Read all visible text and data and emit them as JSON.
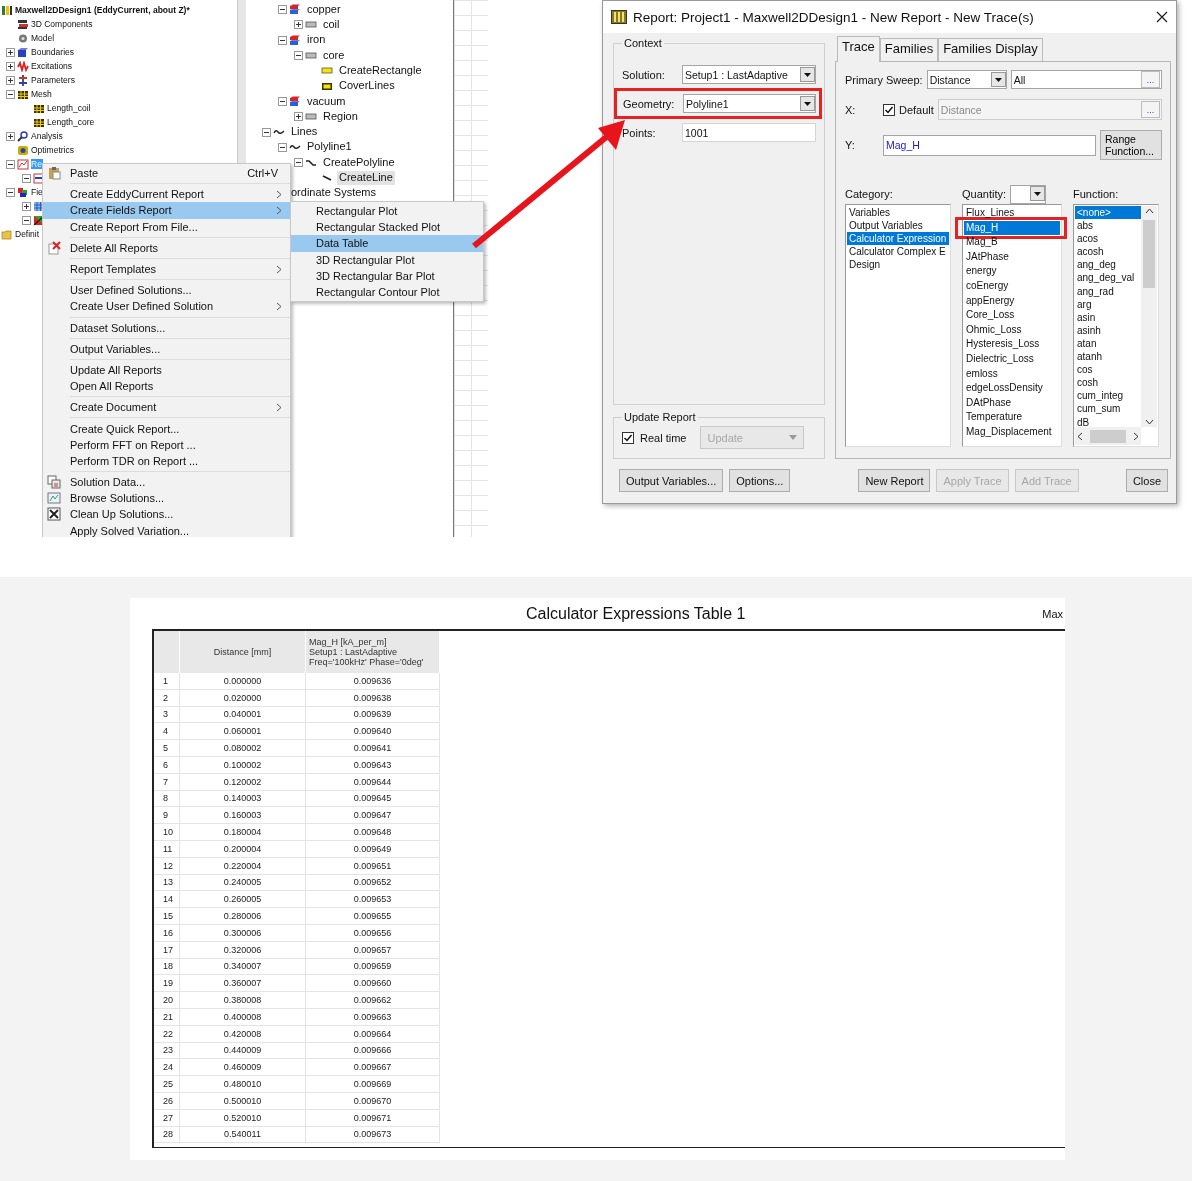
{
  "left_tree": {
    "focused": true,
    "nodes": [
      {
        "label": "Maxwell2DDesign1 (EddyCurrent, about Z)*",
        "kind": "design",
        "selected": false,
        "children": [
          {
            "label": "3D Components",
            "kind": "components",
            "selected": false
          },
          {
            "label": "Model",
            "kind": "model",
            "selected": false
          },
          {
            "label": "Boundaries",
            "kind": "boundary",
            "expanded": false,
            "selected": false
          },
          {
            "label": "Excitations",
            "kind": "excitation",
            "expanded": false,
            "selected": false
          },
          {
            "label": "Parameters",
            "kind": "parameter",
            "expanded": false,
            "selected": false
          },
          {
            "label": "Mesh",
            "kind": "mesh",
            "expanded": true,
            "selected": false,
            "children": [
              {
                "label": "Length_coil",
                "kind": "mesh",
                "selected": false
              },
              {
                "label": "Length_core",
                "kind": "mesh",
                "selected": false
              }
            ]
          },
          {
            "label": "Analysis",
            "kind": "analysis",
            "expanded": false,
            "selected": false
          },
          {
            "label": "Optimetrics",
            "kind": "optimetrics",
            "selected": false
          },
          {
            "label": "Re",
            "kind": "results",
            "expanded": true,
            "selected": true,
            "children": [
              {
                "kind": "plot",
                "expanded": true
              }
            ]
          },
          {
            "label": "Fie",
            "kind": "fields",
            "expanded": true,
            "selected": false,
            "children": [
              {
                "kind": "grid",
                "expanded": false
              },
              {
                "kind": "overlay",
                "expanded": true
              }
            ]
          }
        ]
      },
      {
        "label": "Definit",
        "kind": "folder",
        "selected": false
      }
    ]
  },
  "middle_tree": {
    "focused": false,
    "nodes": [
      {
        "children": [
          {
            "label": "copper",
            "kind": "material",
            "expanded": true,
            "selected": false,
            "children": [
              {
                "label": "coil",
                "kind": "object",
                "expanded": false,
                "selected": false
              }
            ]
          },
          {
            "label": "iron",
            "kind": "material",
            "expanded": true,
            "selected": false,
            "children": [
              {
                "label": "core",
                "kind": "object",
                "expanded": true,
                "selected": false,
                "children": [
                  {
                    "label": "CreateRectangle",
                    "kind": "rectangle",
                    "selected": false
                  },
                  {
                    "label": "CoverLines",
                    "kind": "cover",
                    "selected": false
                  }
                ]
              }
            ]
          },
          {
            "label": "vacuum",
            "kind": "material",
            "expanded": true,
            "selected": false,
            "children": [
              {
                "label": "Region",
                "kind": "object",
                "expanded": false,
                "selected": false
              }
            ]
          }
        ]
      },
      {
        "label": "Lines",
        "kind": "line",
        "expanded": true,
        "selected": false,
        "children": [
          {
            "label": "Polyline1",
            "kind": "line",
            "expanded": true,
            "selected": false,
            "children": [
              {
                "label": "CreatePolyline",
                "kind": "polyline",
                "expanded": true,
                "selected": false,
                "children": [
                  {
                    "label": "CreateLine",
                    "kind": "segment",
                    "selected": true
                  }
                ]
              }
            ]
          }
        ]
      },
      {
        "label": "ordinate Systems",
        "selected": false
      }
    ]
  },
  "context_menu": {
    "groups": [
      [
        {
          "label": "Paste",
          "shortcut": "Ctrl+V",
          "kind": "paste",
          "submenu": false,
          "selected": false
        }
      ],
      [
        {
          "label": "Create EddyCurrent Report",
          "submenu": true,
          "selected": false
        },
        {
          "label": "Create Fields Report",
          "submenu": true,
          "selected": true
        },
        {
          "label": "Create Report From File...",
          "submenu": false,
          "selected": false
        }
      ],
      [
        {
          "label": "Delete All Reports",
          "kind": "delete",
          "submenu": false,
          "selected": false
        }
      ],
      [
        {
          "label": "Report Templates",
          "submenu": true,
          "selected": false
        }
      ],
      [
        {
          "label": "User Defined Solutions...",
          "submenu": false,
          "selected": false
        },
        {
          "label": "Create User Defined Solution",
          "submenu": true,
          "selected": false
        }
      ],
      [
        {
          "label": "Dataset Solutions...",
          "submenu": false,
          "selected": false
        }
      ],
      [
        {
          "label": "Output Variables...",
          "submenu": false,
          "selected": false
        }
      ],
      [
        {
          "label": "Update All Reports",
          "submenu": false,
          "selected": false
        },
        {
          "label": "Open All Reports",
          "submenu": false,
          "selected": false
        }
      ],
      [
        {
          "label": "Create Document",
          "submenu": true,
          "selected": false
        }
      ],
      [
        {
          "label": "Create Quick Report...",
          "submenu": false,
          "selected": false
        },
        {
          "label": "Perform FFT on Report ...",
          "submenu": false,
          "selected": false
        },
        {
          "label": "Perform TDR on Report ...",
          "submenu": false,
          "selected": false
        }
      ],
      [
        {
          "label": "Solution Data...",
          "kind": "data",
          "submenu": false,
          "selected": false
        },
        {
          "label": "Browse Solutions...",
          "kind": "browse",
          "submenu": false,
          "selected": false
        },
        {
          "label": "Clean Up Solutions...",
          "kind": "cleanup",
          "submenu": false,
          "selected": false
        },
        {
          "label": "Apply Solved Variation...",
          "submenu": false,
          "selected": false
        }
      ]
    ]
  },
  "submenu": {
    "items": [
      {
        "label": "Rectangular Plot",
        "selected": false
      },
      {
        "label": "Rectangular Stacked Plot",
        "selected": false
      },
      {
        "label": "Data Table",
        "selected": true
      },
      {
        "label": "3D Rectangular Plot",
        "selected": false
      },
      {
        "label": "3D Rectangular Bar Plot",
        "selected": false
      },
      {
        "label": "Rectangular Contour Plot",
        "selected": false
      }
    ]
  },
  "dialog": {
    "title": "Report: Project1 - Maxwell2DDesign1 - New Report - New Trace(s)",
    "context": {
      "title": "Context",
      "fields": [
        {
          "label": "Solution:",
          "value": "Setup1 : LastAdaptive",
          "kind": "select",
          "highlighted": false
        },
        {
          "label": "Geometry:",
          "value": "Polyline1",
          "kind": "select",
          "highlighted": true
        },
        {
          "label": "Points:",
          "value": "1001",
          "kind": "input",
          "highlighted": false
        }
      ]
    },
    "update_report": {
      "title": "Update Report",
      "realtime": {
        "label": "Real time",
        "checked": true
      },
      "button": {
        "label": "Update",
        "disabled": true
      }
    },
    "tabs": [
      {
        "label": "Trace",
        "selected": true
      },
      {
        "label": "Families",
        "selected": false
      },
      {
        "label": "Families Display",
        "selected": false
      }
    ],
    "primary_sweep": {
      "label": "Primary Sweep:",
      "value": "Distance",
      "range": "All",
      "range_button": "..."
    },
    "x": {
      "label": "X:",
      "default": {
        "label": "Default",
        "checked": true
      },
      "value": "Distance",
      "disabled": true,
      "button": "..."
    },
    "y": {
      "label": "Y:",
      "value": "Mag_H",
      "button": "Range Function..."
    },
    "category": {
      "label": "Category:",
      "items": [
        {
          "label": "Variables",
          "selected": false
        },
        {
          "label": "Output Variables",
          "selected": false
        },
        {
          "label": "Calculator Expression",
          "selected": true
        },
        {
          "label": "Calculator Complex E",
          "selected": false
        },
        {
          "label": "Design",
          "selected": false
        }
      ]
    },
    "quantity": {
      "label": "Quantity:",
      "items": [
        {
          "label": "Flux_Lines",
          "selected": false,
          "highlighted": false
        },
        {
          "label": "Mag_H",
          "selected": true,
          "highlighted": true
        },
        {
          "label": "Mag_B",
          "selected": false,
          "highlighted": false
        },
        {
          "label": "JAtPhase",
          "selected": false,
          "highlighted": false
        },
        {
          "label": "energy",
          "selected": false,
          "highlighted": false
        },
        {
          "label": "coEnergy",
          "selected": false,
          "highlighted": false
        },
        {
          "label": "appEnergy",
          "selected": false,
          "highlighted": false
        },
        {
          "label": "Core_Loss",
          "selected": false,
          "highlighted": false
        },
        {
          "label": "Ohmic_Loss",
          "selected": false,
          "highlighted": false
        },
        {
          "label": "Hysteresis_Loss",
          "selected": false,
          "highlighted": false
        },
        {
          "label": "Dielectric_Loss",
          "selected": false,
          "highlighted": false
        },
        {
          "label": "emloss",
          "selected": false,
          "highlighted": false
        },
        {
          "label": "edgeLossDensity",
          "selected": false,
          "highlighted": false
        },
        {
          "label": "DAtPhase",
          "selected": false,
          "highlighted": false
        },
        {
          "label": "Temperature",
          "selected": false,
          "highlighted": false
        },
        {
          "label": "Mag_Displacement",
          "selected": false,
          "highlighted": false
        }
      ]
    },
    "function": {
      "label": "Function:",
      "items": [
        {
          "label": "<none>",
          "selected": true
        },
        {
          "label": "abs",
          "selected": false
        },
        {
          "label": "acos",
          "selected": false
        },
        {
          "label": "acosh",
          "selected": false
        },
        {
          "label": "ang_deg",
          "selected": false
        },
        {
          "label": "ang_deg_val",
          "selected": false
        },
        {
          "label": "ang_rad",
          "selected": false
        },
        {
          "label": "arg",
          "selected": false
        },
        {
          "label": "asin",
          "selected": false
        },
        {
          "label": "asinh",
          "selected": false
        },
        {
          "label": "atan",
          "selected": false
        },
        {
          "label": "atanh",
          "selected": false
        },
        {
          "label": "cos",
          "selected": false
        },
        {
          "label": "cosh",
          "selected": false
        },
        {
          "label": "cum_integ",
          "selected": false
        },
        {
          "label": "cum_sum",
          "selected": false
        },
        {
          "label": "dB",
          "selected": false
        }
      ]
    },
    "left_buttons": [
      {
        "label": "Output Variables...",
        "disabled": false
      },
      {
        "label": "Options...",
        "disabled": false
      }
    ],
    "trace_buttons": [
      {
        "label": "New Report",
        "disabled": false
      },
      {
        "label": "Apply Trace",
        "disabled": true
      },
      {
        "label": "Add Trace",
        "disabled": true
      }
    ],
    "close_button": {
      "label": "Close",
      "disabled": false
    }
  },
  "report": {
    "title": "Calculator Expressions Table 1",
    "legend_label": "Max",
    "columns": [
      {
        "kind": "index"
      },
      {
        "lines": [
          "Distance [mm]"
        ]
      },
      {
        "lines": [
          "Mag_H [kA_per_m]",
          "Setup1 : LastAdaptive",
          "Freq='100kHz' Phase='0deg'"
        ]
      }
    ],
    "rows": [
      [
        "1",
        "0.000000",
        "0.009636"
      ],
      [
        "2",
        "0.020000",
        "0.009638"
      ],
      [
        "3",
        "0.040001",
        "0.009639"
      ],
      [
        "4",
        "0.060001",
        "0.009640"
      ],
      [
        "5",
        "0.080002",
        "0.009641"
      ],
      [
        "6",
        "0.100002",
        "0.009643"
      ],
      [
        "7",
        "0.120002",
        "0.009644"
      ],
      [
        "8",
        "0.140003",
        "0.009645"
      ],
      [
        "9",
        "0.160003",
        "0.009647"
      ],
      [
        "10",
        "0.180004",
        "0.009648"
      ],
      [
        "11",
        "0.200004",
        "0.009649"
      ],
      [
        "12",
        "0.220004",
        "0.009651"
      ],
      [
        "13",
        "0.240005",
        "0.009652"
      ],
      [
        "14",
        "0.260005",
        "0.009653"
      ],
      [
        "15",
        "0.280006",
        "0.009655"
      ],
      [
        "16",
        "0.300006",
        "0.009656"
      ],
      [
        "17",
        "0.320006",
        "0.009657"
      ],
      [
        "18",
        "0.340007",
        "0.009659"
      ],
      [
        "19",
        "0.360007",
        "0.009660"
      ],
      [
        "20",
        "0.380008",
        "0.009662"
      ],
      [
        "21",
        "0.400008",
        "0.009663"
      ],
      [
        "22",
        "0.420008",
        "0.009664"
      ],
      [
        "23",
        "0.440009",
        "0.009666"
      ],
      [
        "24",
        "0.460009",
        "0.009667"
      ],
      [
        "25",
        "0.480010",
        "0.009669"
      ],
      [
        "26",
        "0.500010",
        "0.009670"
      ],
      [
        "27",
        "0.520010",
        "0.009671"
      ],
      [
        "28",
        "0.540011",
        "0.009673"
      ]
    ]
  }
}
